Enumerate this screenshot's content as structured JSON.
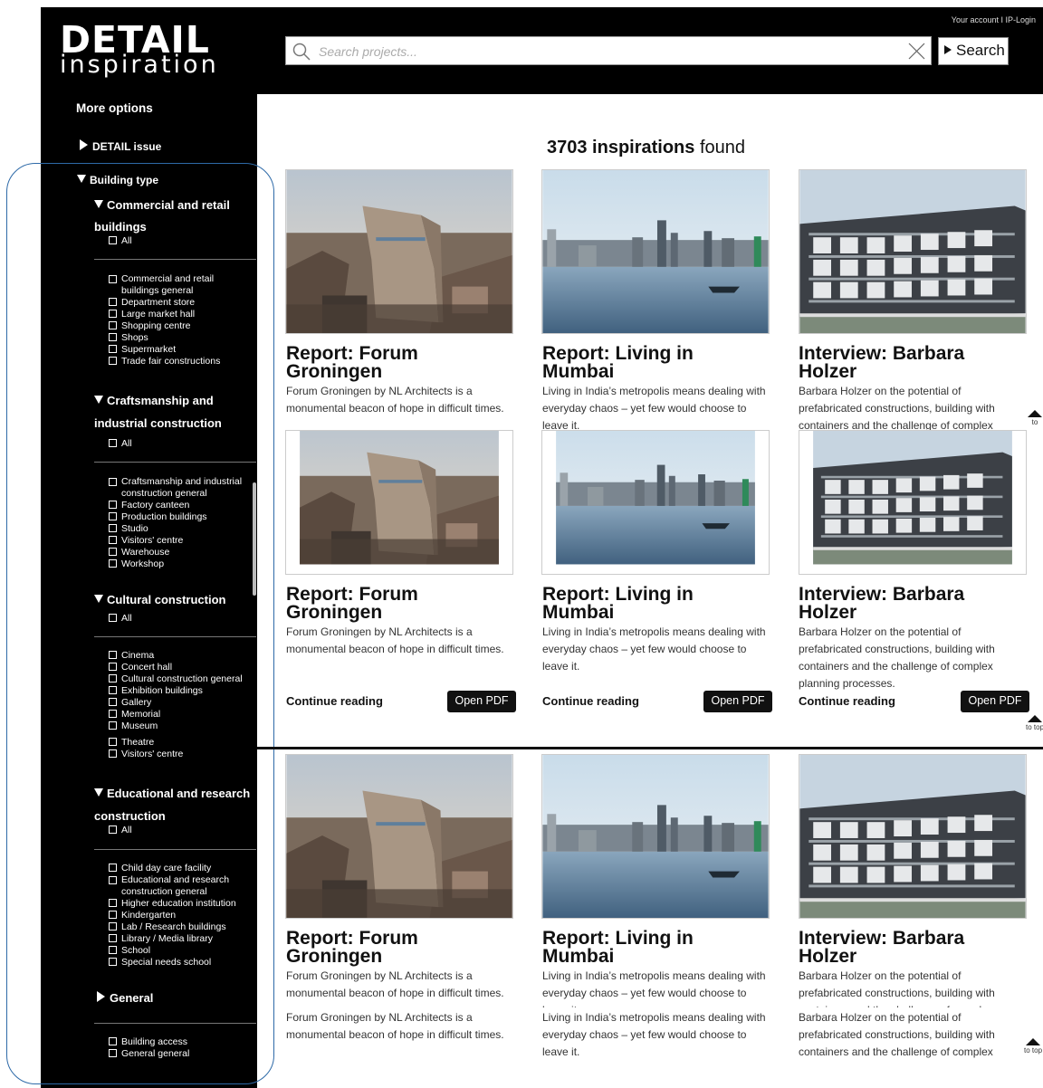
{
  "header": {
    "logo_main": "DETAIL",
    "logo_sub": "inspiration",
    "account": "Your account  I  IP-Login",
    "search_placeholder": "Search projects...",
    "search_button": "Search"
  },
  "sidebar": {
    "more_options": "More options",
    "detail_issue": "DETAIL issue",
    "building_type": "Building type",
    "all_label": "All",
    "groups": [
      {
        "title": "Commercial and retail buildings",
        "items": [
          "Commercial and retail buildings general",
          "Department store",
          "Large market hall",
          "Shopping centre",
          "Shops",
          "Supermarket",
          "Trade fair constructions"
        ]
      },
      {
        "title": "Craftsmanship and industrial construction",
        "items": [
          "Craftsmanship and industrial construction general",
          "Factory canteen",
          "Production buildings",
          "Studio",
          "Visitors' centre",
          "Warehouse",
          "Workshop"
        ]
      },
      {
        "title": "Cultural construction",
        "items": [
          "Cinema",
          "Concert hall",
          "Cultural construction general",
          "Exhibition buildings",
          "Gallery",
          "Memorial",
          "Museum",
          "Theatre",
          "Visitors' centre"
        ]
      },
      {
        "title": "Educational and research construction",
        "items": [
          "Child day care facility",
          "Educational and research construction general",
          "Higher education institution",
          "Kindergarten",
          "Lab / Research buildings",
          "Library / Media library",
          "School",
          "Special needs school"
        ]
      },
      {
        "title": "General",
        "items": [
          "Building access",
          "General general"
        ]
      }
    ]
  },
  "results": {
    "count": "3703 inspirations",
    "found": "found",
    "continue_reading": "Continue reading",
    "open_pdf": "Open PDF",
    "to_top": "to top",
    "to": "to",
    "cards": [
      {
        "title": "Report: Forum Groningen",
        "desc": "Forum Groningen by NL Architects is a monumental beacon of hope in difficult times."
      },
      {
        "title": "Report: Living in Mumbai",
        "desc": "Living in India’s metropolis means dealing with everyday chaos – yet few would choose to leave it."
      },
      {
        "title": "Interview: Barbara Holzer",
        "desc": "Barbara Holzer on the potential of prefabricated constructions, building with containers and the challenge of complex planning processes.",
        "desc_short": "Barbara Holzer on the potential of prefabricated constructions, building with containers and the challenge of complex"
      }
    ]
  }
}
